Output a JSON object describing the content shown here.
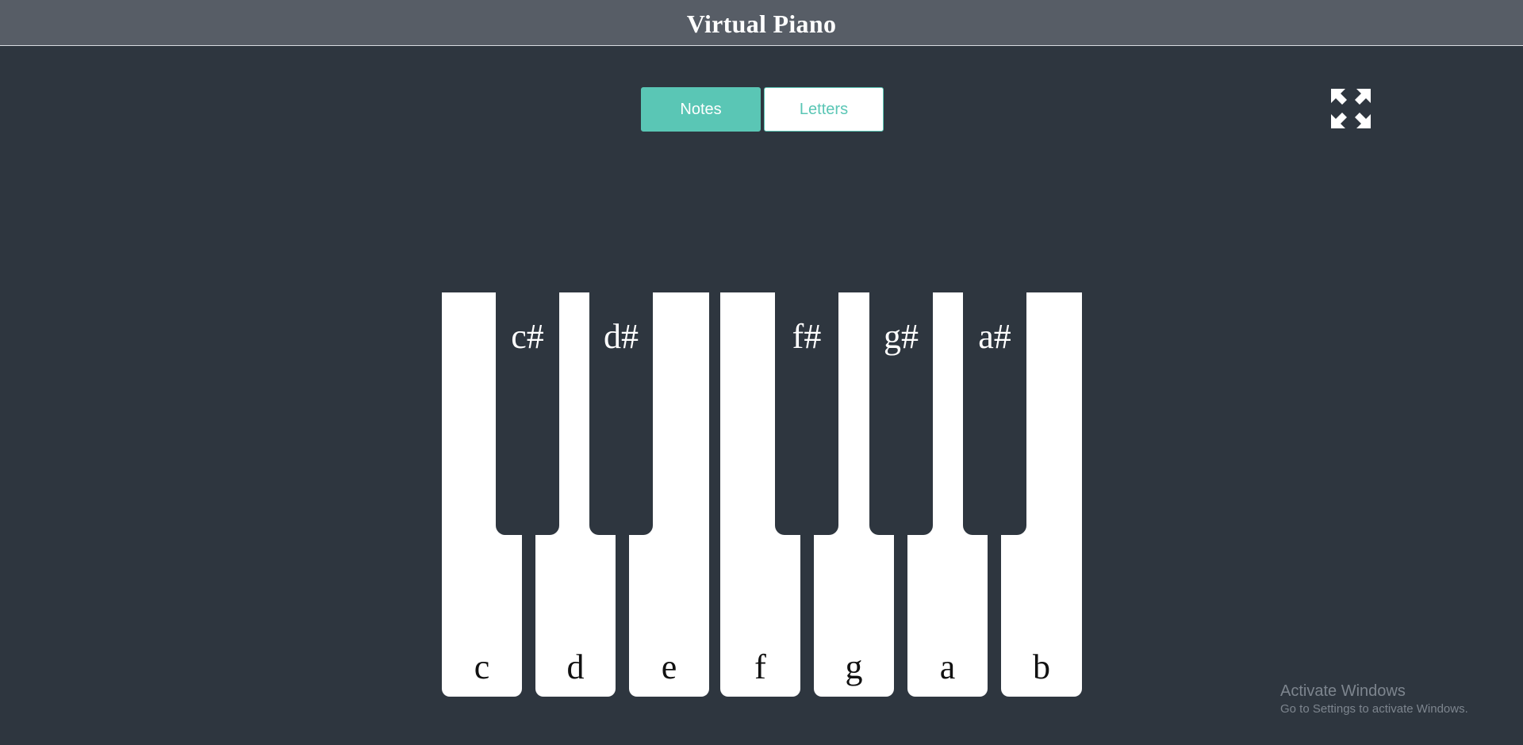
{
  "header": {
    "title": "Virtual Piano"
  },
  "mode_toggle": {
    "notes_label": "Notes",
    "letters_label": "Letters",
    "selected": "Notes"
  },
  "fullscreen": {
    "icon": "expand-arrows-icon"
  },
  "piano": {
    "white_keys": [
      {
        "label": "c"
      },
      {
        "label": "d"
      },
      {
        "label": "e"
      },
      {
        "label": "f"
      },
      {
        "label": "g"
      },
      {
        "label": "a"
      },
      {
        "label": "b"
      }
    ],
    "black_keys": [
      {
        "label": "c#"
      },
      {
        "label": "d#"
      },
      {
        "label": "f#"
      },
      {
        "label": "g#"
      },
      {
        "label": "a#"
      }
    ]
  },
  "watermark": {
    "title": "Activate Windows",
    "subtitle": "Go to Settings to activate Windows."
  },
  "colors": {
    "background": "#2e363f",
    "header": "#575d66",
    "accent": "#5ac6b5",
    "white_key": "#ffffff"
  }
}
